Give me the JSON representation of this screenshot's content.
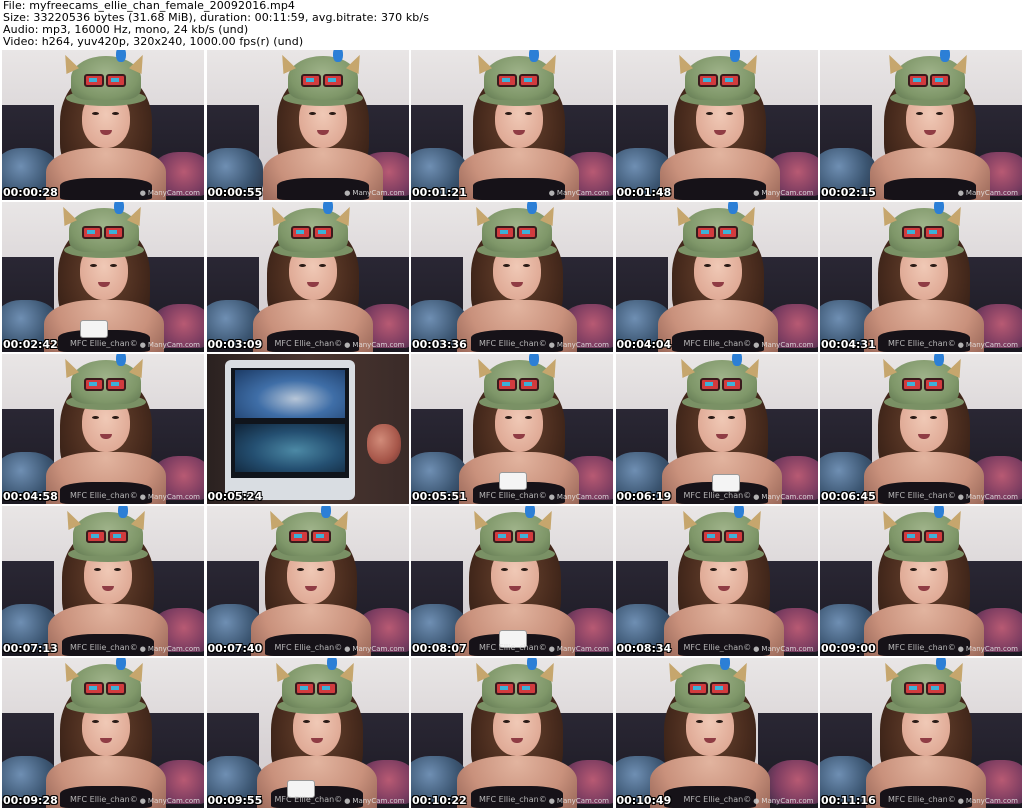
{
  "header": {
    "file": "File: myfreecams_ellie_chan_female_20092016.mp4",
    "size": "Size: 33220536 bytes (31.68 MiB), duration: 00:11:59, avg.bitrate: 370 kb/s",
    "audio": "Audio: mp3, 16000 Hz, mono, 24 kb/s (und)",
    "video": "Video: h264, yuv420p, 320x240, 1000.00 fps(r) (und)"
  },
  "thumbnails": [
    {
      "timestamp": "00:00:28"
    },
    {
      "timestamp": "00:00:55"
    },
    {
      "timestamp": "00:01:21"
    },
    {
      "timestamp": "00:01:48"
    },
    {
      "timestamp": "00:02:15"
    },
    {
      "timestamp": "00:02:42",
      "watermark": "MFC Ellie_chan©"
    },
    {
      "timestamp": "00:03:09",
      "watermark": "MFC Ellie_chan©"
    },
    {
      "timestamp": "00:03:36",
      "watermark": "MFC Ellie_chan©"
    },
    {
      "timestamp": "00:04:04",
      "watermark": "MFC Ellie_chan©"
    },
    {
      "timestamp": "00:04:31",
      "watermark": "MFC Ellie_chan©"
    },
    {
      "timestamp": "00:04:58",
      "watermark": "MFC Ellie_chan©"
    },
    {
      "timestamp": "00:05:24"
    },
    {
      "timestamp": "00:05:51",
      "watermark": "MFC Ellie_chan©"
    },
    {
      "timestamp": "00:06:19",
      "watermark": "MFC Ellie_chan©"
    },
    {
      "timestamp": "00:06:45",
      "watermark": "MFC Ellie_chan©"
    },
    {
      "timestamp": "00:07:13",
      "watermark": "MFC Ellie_chan©"
    },
    {
      "timestamp": "00:07:40",
      "watermark": "MFC Ellie_chan©"
    },
    {
      "timestamp": "00:08:07",
      "watermark": "MFC Ellie_chan©"
    },
    {
      "timestamp": "00:08:34",
      "watermark": "MFC Ellie_chan©"
    },
    {
      "timestamp": "00:09:00",
      "watermark": "MFC Ellie_chan©"
    },
    {
      "timestamp": "00:09:28",
      "watermark": "MFC Ellie_chan©"
    },
    {
      "timestamp": "00:09:55",
      "watermark": "MFC Ellie_chan©"
    },
    {
      "timestamp": "00:10:22",
      "watermark": "MFC Ellie_chan©"
    },
    {
      "timestamp": "00:10:49",
      "watermark": "MFC Ellie_chan©"
    },
    {
      "timestamp": "00:11:16",
      "watermark": "MFC Ellie_chan©"
    }
  ],
  "overlay_label": "ManyCam.com"
}
